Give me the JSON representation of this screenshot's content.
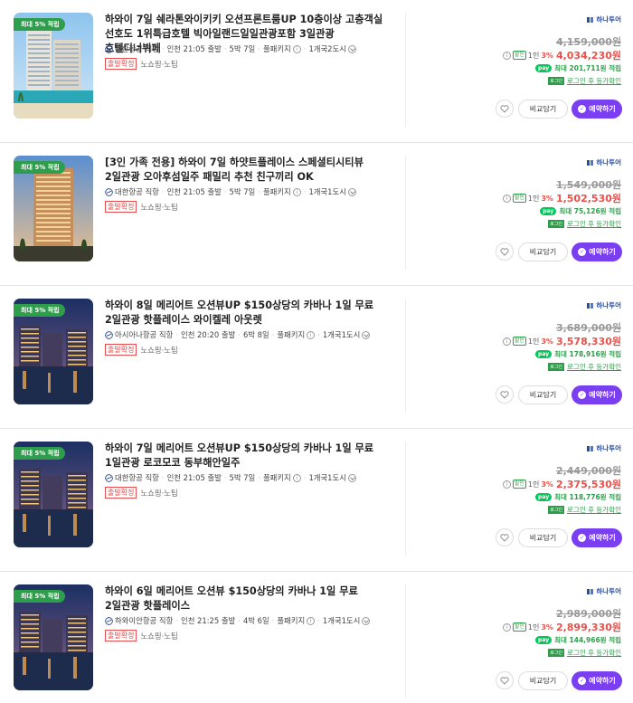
{
  "items": [
    {
      "badge": "최대 5% 적립",
      "title": "하와이 7일 쉐라톤와이키키 오션프론트룸UP 10층이상 고층객실 선호도 1위특급호텔 빅아일랜드일일관광포함 3일관광 호텔디너뷔페",
      "airline": "대한항공 직항",
      "departure": "인천 21:05 출발",
      "duration": "5박 7일",
      "package": "풀패키지",
      "cities": "1개국2도시",
      "tag_red": "출발확정",
      "tag_shopping": "노쇼핑",
      "tag_tip": "노팁",
      "brand": "하나투어",
      "original_price": "4,159,000원",
      "sale_people": "1인",
      "sale_pct": "3%",
      "sale_price": "4,034,230원",
      "npay_text": "최대 201,711원 적립",
      "login_text": "로그인 후 등가확인",
      "scene": "towers"
    },
    {
      "badge": "최대 5% 적립",
      "title": "[3인 가족 전용] 하와이 7일 하얏트플레이스 스페셜티시티뷰 2일관광 오아후섬일주 패밀리 추천 친구끼리 OK",
      "airline": "대한항공 직항",
      "departure": "인천 21:05 출발",
      "duration": "5박 7일",
      "package": "풀패키지",
      "cities": "1개국1도시",
      "tag_red": "출발확정",
      "tag_shopping": "노쇼핑",
      "tag_tip": "노팁",
      "brand": "하나투어",
      "original_price": "1,549,000원",
      "sale_people": "1인",
      "sale_pct": "3%",
      "sale_price": "1,502,530원",
      "npay_text": "최대 75,126원 적립",
      "login_text": "로그인 후 등가확인",
      "scene": "hyatt"
    },
    {
      "badge": "최대 5% 적립",
      "title": "하와이 8일 메리어트 오션뷰UP $150상당의 카바나 1일 무료 2일관광 핫플레이스 와이켈레 아웃렛",
      "airline": "아시아나항공 직항",
      "departure": "인천 20:20 출발",
      "duration": "6박 8일",
      "package": "풀패키지",
      "cities": "1개국1도시",
      "tag_red": "출발확정",
      "tag_shopping": "노쇼핑",
      "tag_tip": "노팁",
      "brand": "하나투어",
      "original_price": "3,689,000원",
      "sale_people": "1인",
      "sale_pct": "3%",
      "sale_price": "3,578,330원",
      "npay_text": "최대 178,916원 적립",
      "login_text": "로그인 후 등가확인",
      "scene": "night"
    },
    {
      "badge": "최대 5% 적립",
      "title": "하와이 7일 메리어트 오션뷰UP $150상당의 카바나 1일 무료 1일관광 로코모코 동부해안일주",
      "airline": "대한항공 직항",
      "departure": "인천 21:05 출발",
      "duration": "5박 7일",
      "package": "풀패키지",
      "cities": "1개국1도시",
      "tag_red": "출발확정",
      "tag_shopping": "노쇼핑",
      "tag_tip": "노팁",
      "brand": "하나투어",
      "original_price": "2,449,000원",
      "sale_people": "1인",
      "sale_pct": "3%",
      "sale_price": "2,375,530원",
      "npay_text": "최대 118,776원 적립",
      "login_text": "로그인 후 등가확인",
      "scene": "night"
    },
    {
      "badge": "최대 5% 적립",
      "title": "하와이 6일 메리어트 오션뷰 $150상당의 카바나 1일 무료 2일관광 핫플레이스",
      "airline": "하와이안항공 직항",
      "departure": "인천 21:25 출발",
      "duration": "4박 6일",
      "package": "풀패키지",
      "cities": "1개국1도시",
      "tag_red": "출발확정",
      "tag_shopping": "노쇼핑",
      "tag_tip": "노팁",
      "brand": "하나투어",
      "original_price": "2,989,000원",
      "sale_people": "1인",
      "sale_pct": "3%",
      "sale_price": "2,899,330원",
      "npay_text": "최대 144,966원 적립",
      "login_text": "로그인 후 등가확인",
      "scene": "night"
    }
  ],
  "labels": {
    "discount_tag": "할인",
    "npay": "pay",
    "login_tag": "로그인",
    "compare_button": "비교담기",
    "book_button": "예약하기"
  },
  "colors": {
    "accent_purple": "#7b3ff2",
    "price_red": "#e8504a",
    "npay_green": "#03c75a",
    "badge_green": "#2e9e4c",
    "brand_blue": "#2a4d9c"
  }
}
